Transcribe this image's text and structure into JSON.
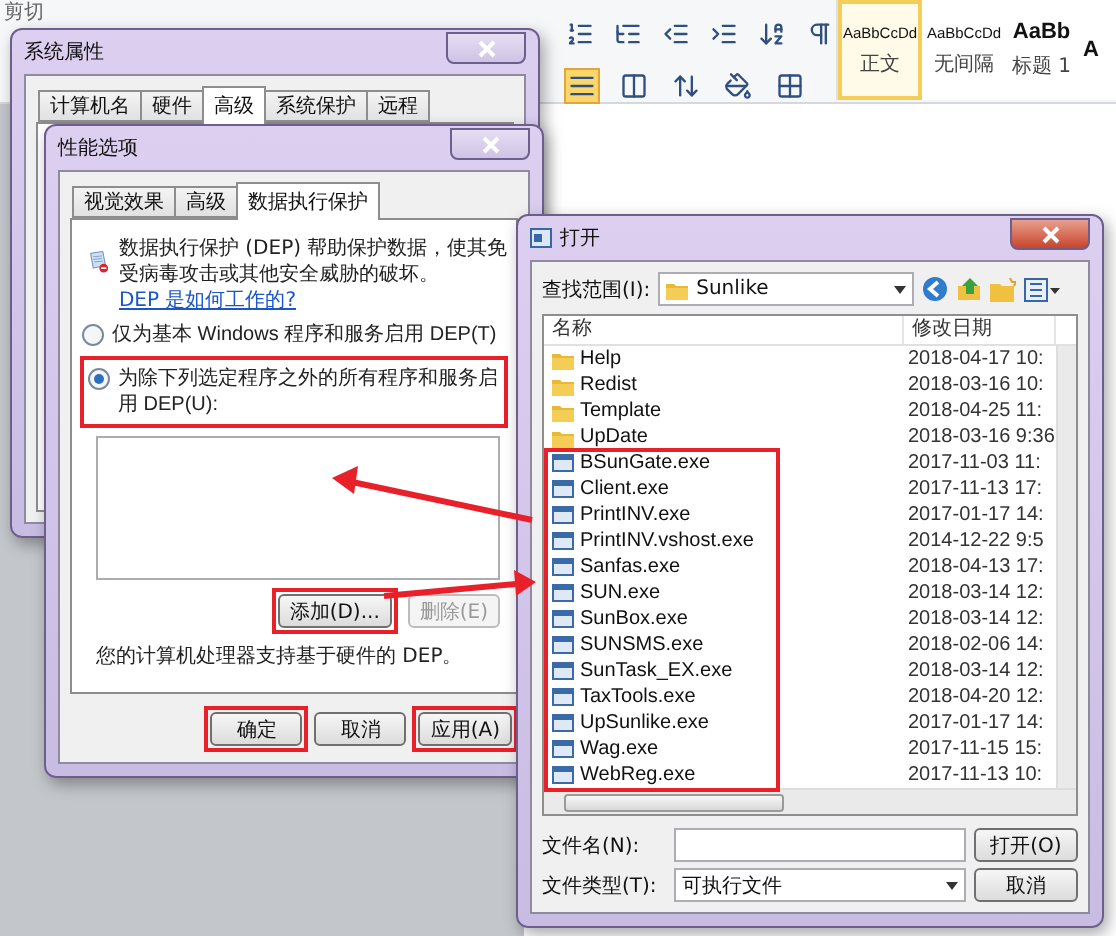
{
  "ribbon": {
    "clipboard_label": "剪切",
    "styles": [
      {
        "preview": "AaBbCcDd",
        "name": "正文",
        "selected": true,
        "kind": "small"
      },
      {
        "preview": "AaBbCcDd",
        "name": "无间隔",
        "selected": false,
        "kind": "small"
      },
      {
        "preview": "AaBb",
        "name": "标题 1",
        "selected": false,
        "kind": "heading"
      },
      {
        "preview": "A",
        "selected": false,
        "kind": "heading"
      }
    ]
  },
  "system_properties": {
    "title": "系统属性",
    "tabs": [
      {
        "label": "计算机名",
        "selected": false
      },
      {
        "label": "硬件",
        "selected": false
      },
      {
        "label": "高级",
        "selected": true
      },
      {
        "label": "系统保护",
        "selected": false
      },
      {
        "label": "远程",
        "selected": false
      }
    ]
  },
  "performance_options": {
    "title": "性能选项",
    "tabs": [
      {
        "label": "视觉效果",
        "selected": false
      },
      {
        "label": "高级",
        "selected": false
      },
      {
        "label": "数据执行保护",
        "selected": true
      }
    ],
    "description": "数据执行保护 (DEP) 帮助保护数据，使其免受病毒攻击或其他安全威胁的破坏。",
    "link": "DEP 是如何工作的?",
    "options": [
      {
        "label": "仅为基本 Windows 程序和服务启用 DEP(T)",
        "selected": false,
        "highlighted": false
      },
      {
        "label": "为除下列选定程序之外的所有程序和服务启用 DEP(U):",
        "selected": true,
        "highlighted": true
      }
    ],
    "list_buttons": [
      {
        "label": "添加(D)...",
        "disabled": false,
        "highlighted": true
      },
      {
        "label": "删除(E)",
        "disabled": true,
        "highlighted": false
      }
    ],
    "note": "您的计算机处理器支持基于硬件的 DEP。",
    "footer_buttons": [
      {
        "label": "确定",
        "highlighted": true
      },
      {
        "label": "取消",
        "highlighted": false
      },
      {
        "label": "应用(A)",
        "highlighted": true
      }
    ]
  },
  "open_dialog": {
    "title": "打开",
    "look_in_label": "查找范围(I):",
    "look_in_value": "Sunlike",
    "columns": [
      "名称",
      "修改日期"
    ],
    "files": [
      {
        "name": "Help",
        "date": "2018-04-17 10:",
        "kind": "folder",
        "highlighted": false
      },
      {
        "name": "Redist",
        "date": "2018-03-16 10:",
        "kind": "folder",
        "highlighted": false
      },
      {
        "name": "Template",
        "date": "2018-04-25 11:",
        "kind": "folder",
        "highlighted": false
      },
      {
        "name": "UpDate",
        "date": "2018-03-16 9:36",
        "kind": "folder",
        "highlighted": false
      },
      {
        "name": "BSunGate.exe",
        "date": "2017-11-03 11:",
        "kind": "app",
        "highlighted": true
      },
      {
        "name": "Client.exe",
        "date": "2017-11-13 17:",
        "kind": "app",
        "highlighted": true
      },
      {
        "name": "PrintINV.exe",
        "date": "2017-01-17 14:",
        "kind": "app",
        "highlighted": true
      },
      {
        "name": "PrintINV.vshost.exe",
        "date": "2014-12-22 9:5",
        "kind": "app",
        "highlighted": true
      },
      {
        "name": "Sanfas.exe",
        "date": "2018-04-13 17:",
        "kind": "app",
        "highlighted": true
      },
      {
        "name": "SUN.exe",
        "date": "2018-03-14 12:",
        "kind": "app",
        "highlighted": true
      },
      {
        "name": "SunBox.exe",
        "date": "2018-03-14 12:",
        "kind": "app",
        "highlighted": true
      },
      {
        "name": "SUNSMS.exe",
        "date": "2018-02-06 14:",
        "kind": "app",
        "highlighted": true
      },
      {
        "name": "SunTask_EX.exe",
        "date": "2018-03-14 12:",
        "kind": "app",
        "highlighted": true
      },
      {
        "name": "TaxTools.exe",
        "date": "2018-04-20 12:",
        "kind": "app",
        "highlighted": true
      },
      {
        "name": "UpSunlike.exe",
        "date": "2017-01-17 14:",
        "kind": "app",
        "highlighted": true
      },
      {
        "name": "Wag.exe",
        "date": "2017-11-15 15:",
        "kind": "app",
        "highlighted": true
      },
      {
        "name": "WebReg.exe",
        "date": "2017-11-13 10:",
        "kind": "app",
        "highlighted": true
      }
    ],
    "file_name_label": "文件名(N):",
    "file_type_label": "文件类型(T):",
    "file_type_value": "可执行文件",
    "buttons": [
      "打开(O)",
      "取消"
    ]
  }
}
